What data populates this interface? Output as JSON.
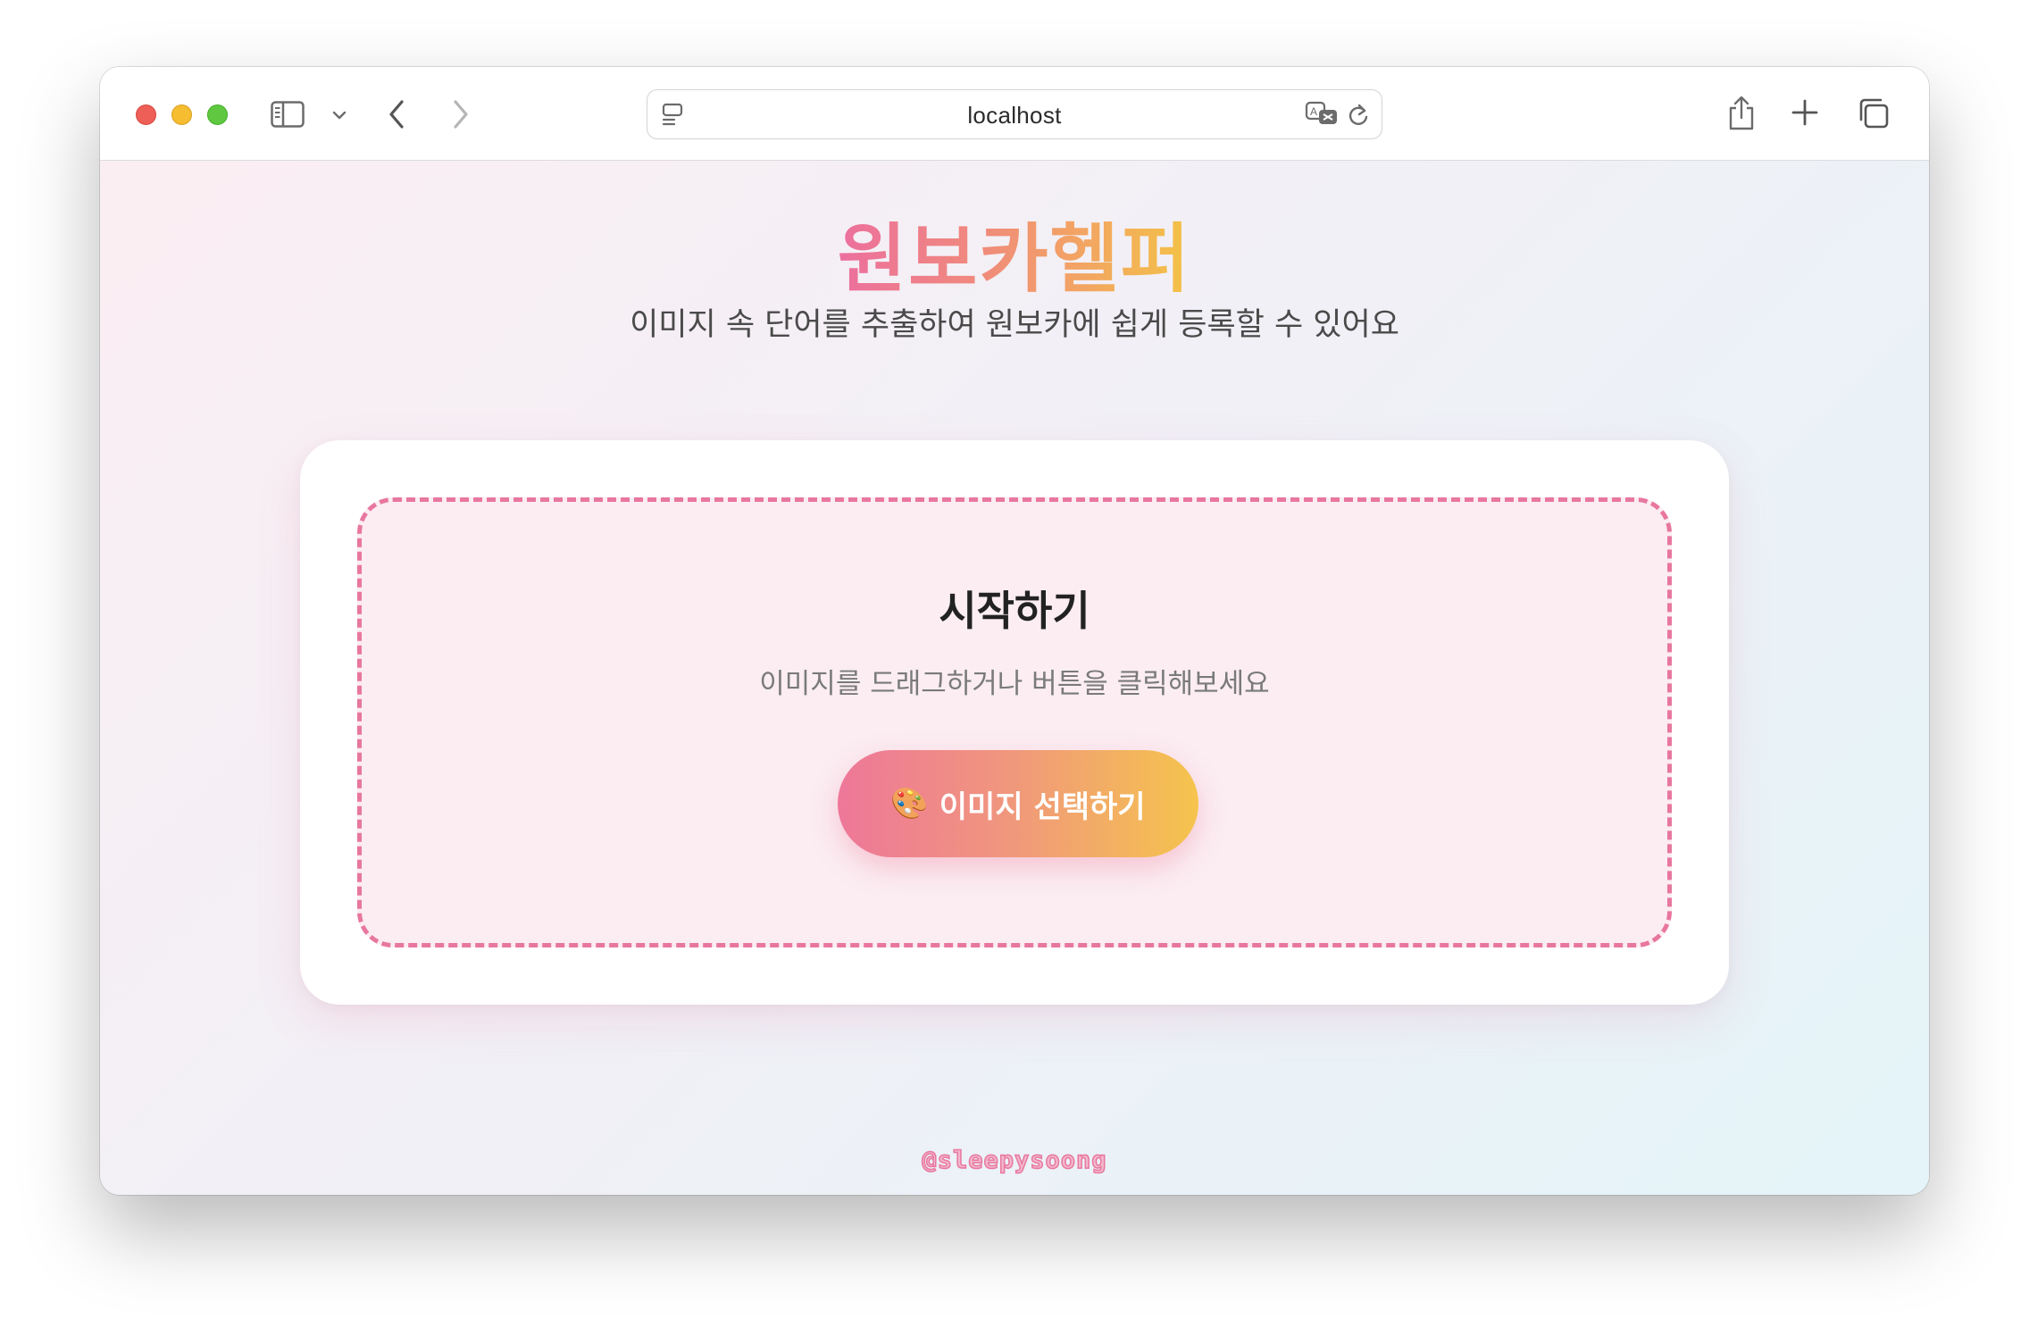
{
  "browser": {
    "address": "localhost"
  },
  "app": {
    "title": "원보카헬퍼",
    "subtitle": "이미지 속 단어를 추출하여 원보카에 쉽게 등록할 수 있어요"
  },
  "upload": {
    "heading": "시작하기",
    "description": "이미지를 드래그하거나 버튼을 클릭해보세요",
    "button_icon": "🎨",
    "button_label": "이미지 선택하기"
  },
  "footer": {
    "handle": "@sleepysoong"
  },
  "colors": {
    "accent_pink": "#e8779f",
    "accent_yellow": "#f5c44d",
    "dropzone_bg": "#fbedf2"
  }
}
